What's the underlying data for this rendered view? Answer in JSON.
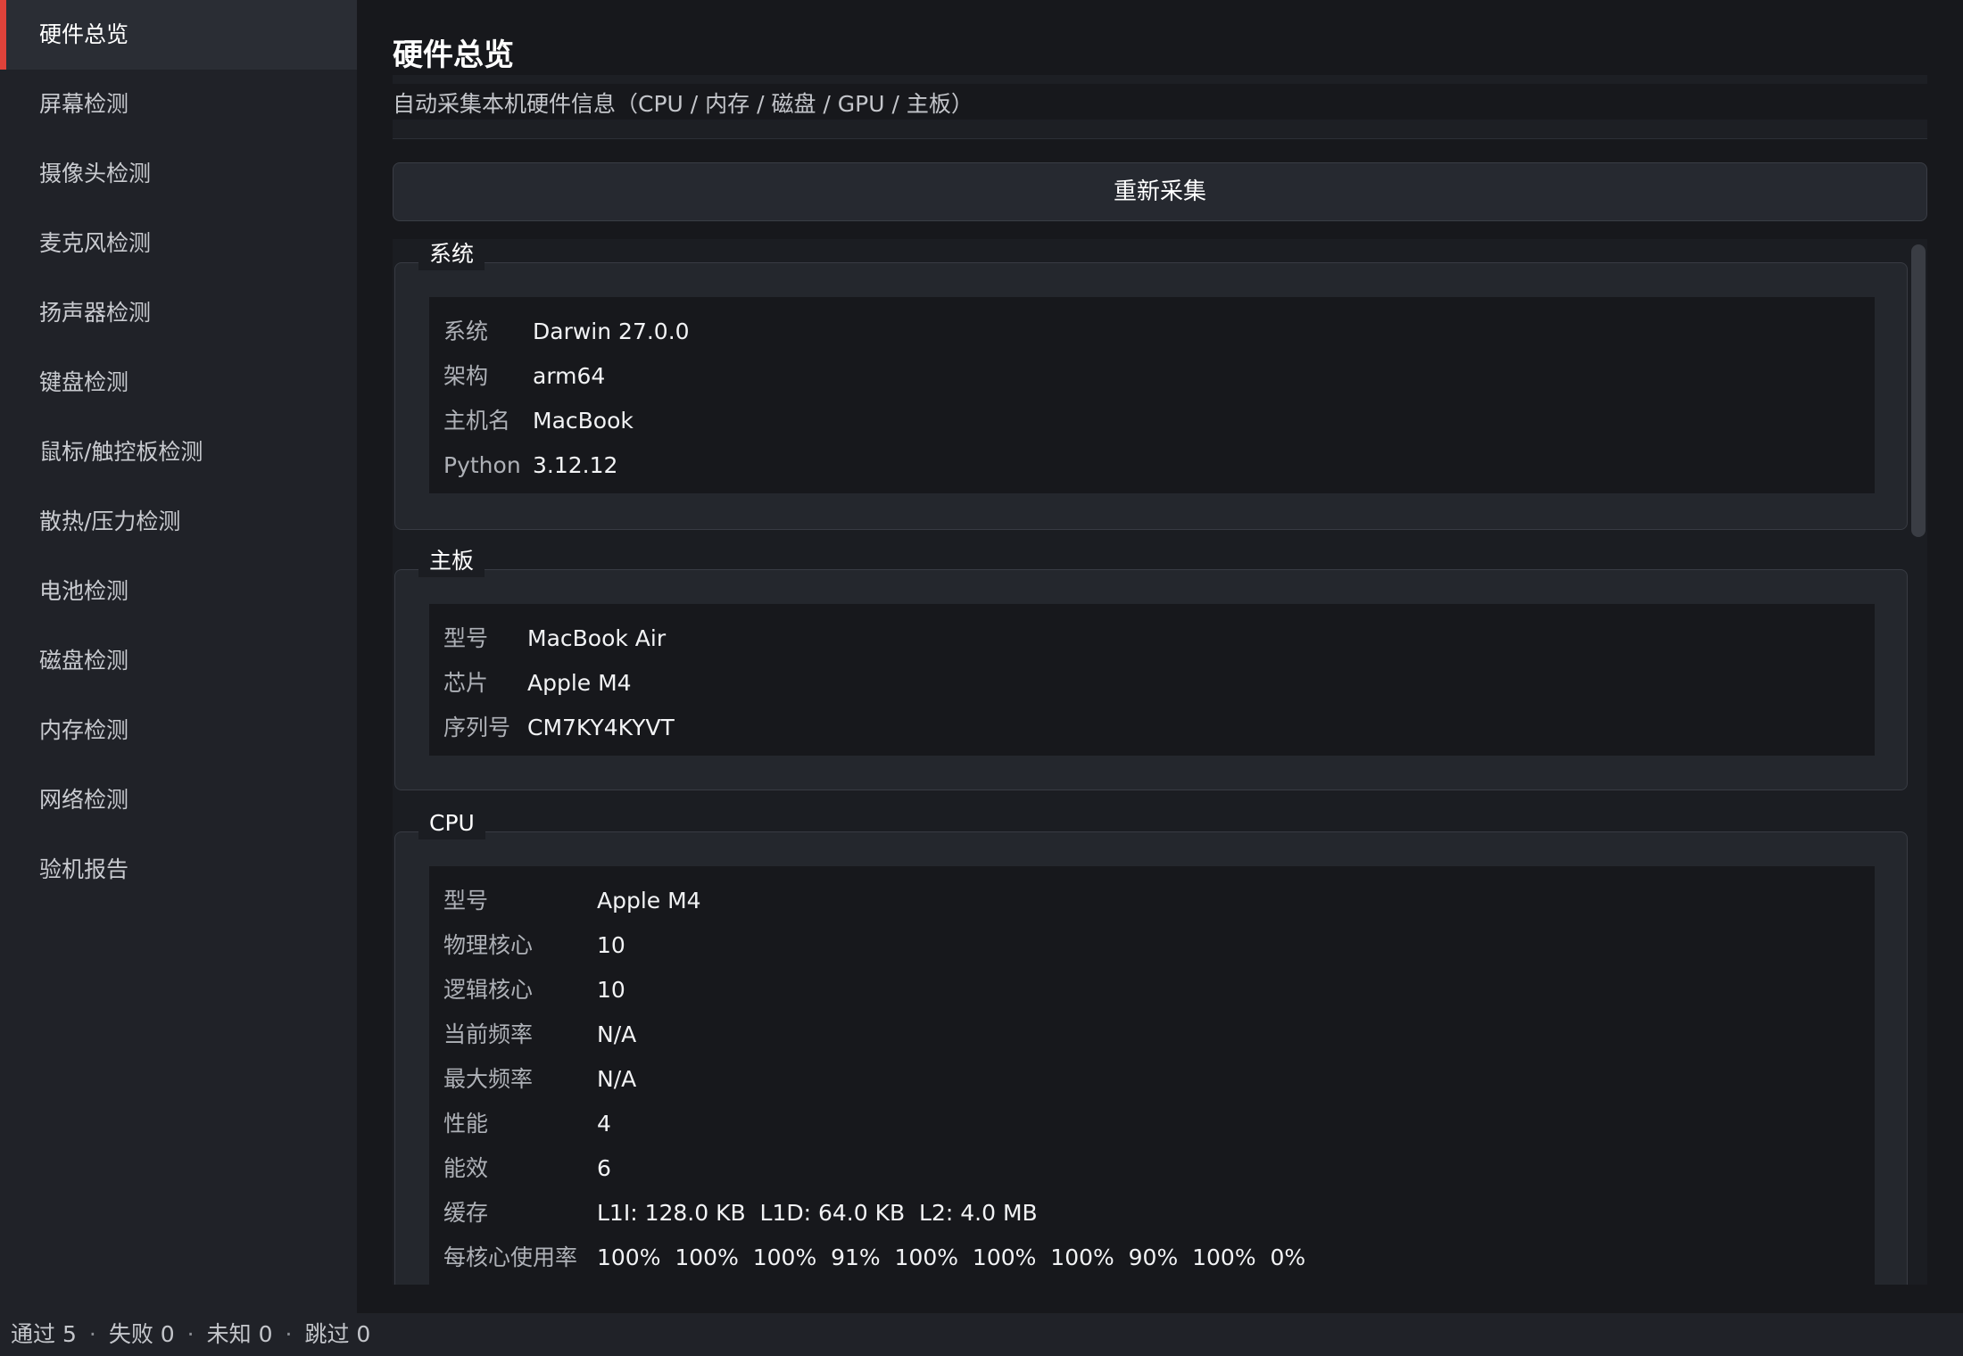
{
  "sidebar": {
    "items": [
      {
        "label": "硬件总览",
        "active": true
      },
      {
        "label": "屏幕检测"
      },
      {
        "label": "摄像头检测"
      },
      {
        "label": "麦克风检测"
      },
      {
        "label": "扬声器检测"
      },
      {
        "label": "键盘检测"
      },
      {
        "label": "鼠标/触控板检测"
      },
      {
        "label": "散热/压力检测"
      },
      {
        "label": "电池检测"
      },
      {
        "label": "磁盘检测"
      },
      {
        "label": "内存检测"
      },
      {
        "label": "网络检测"
      },
      {
        "label": "验机报告"
      }
    ]
  },
  "main": {
    "title": "硬件总览",
    "subtitle": "自动采集本机硬件信息（CPU / 内存 / 磁盘 / GPU / 主板）",
    "refresh_label": "重新采集",
    "groups": {
      "system": {
        "title": "系统",
        "rows": [
          {
            "k": "系统",
            "v": "Darwin 27.0.0"
          },
          {
            "k": "架构",
            "v": "arm64"
          },
          {
            "k": "主机名",
            "v": "MacBook"
          },
          {
            "k": "Python",
            "v": "3.12.12"
          }
        ]
      },
      "board": {
        "title": "主板",
        "rows": [
          {
            "k": "型号",
            "v": "MacBook Air"
          },
          {
            "k": "芯片",
            "v": "Apple M4"
          },
          {
            "k": "序列号",
            "v": "CM7KY4KYVT"
          }
        ]
      },
      "cpu": {
        "title": "CPU",
        "rows": [
          {
            "k": "型号",
            "v": "Apple M4"
          },
          {
            "k": "物理核心",
            "v": "10"
          },
          {
            "k": "逻辑核心",
            "v": "10"
          },
          {
            "k": "当前频率",
            "v": "N/A"
          },
          {
            "k": "最大频率",
            "v": "N/A"
          },
          {
            "k": "性能",
            "v": "4"
          },
          {
            "k": "能效",
            "v": "6"
          },
          {
            "k": "缓存",
            "v": "L1I: 128.0 KB  L1D: 64.0 KB  L2: 4.0 MB"
          },
          {
            "k": "每核心使用率",
            "v": "100%  100%  100%  91%  100%  100%  100%  90%  100%  0%"
          }
        ]
      }
    }
  },
  "status": {
    "pass": "通过 5",
    "fail": "失败 0",
    "unknown": "未知 0",
    "skip": "跳过 0",
    "separator": "·"
  },
  "colors": {
    "accent": "#e0423a",
    "background": "#17181c",
    "sidebar": "#202228"
  }
}
